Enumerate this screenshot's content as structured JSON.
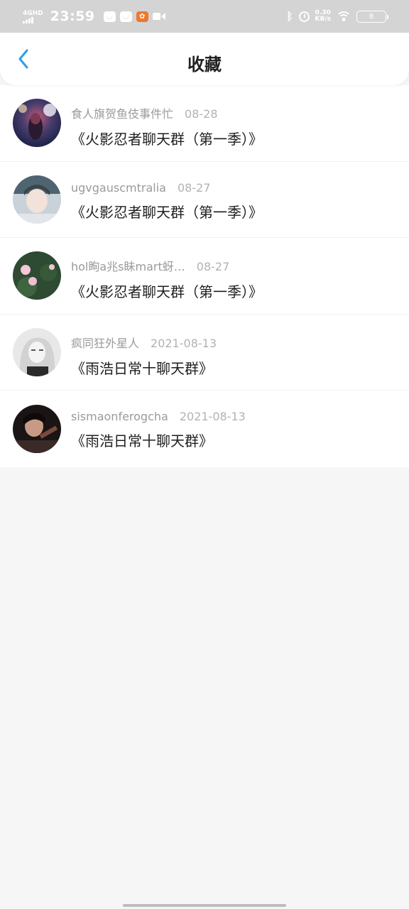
{
  "status_bar": {
    "network_type": "4GHD",
    "time": "23:59",
    "speed_value": "0.30",
    "speed_unit": "KB/s",
    "battery": "8"
  },
  "header": {
    "title": "收藏",
    "back_icon": "chevron-left-icon",
    "accent_color": "#2b9fe6"
  },
  "favorites": [
    {
      "sender": "食人旗贺鱼伎事件忙",
      "date": "08-28",
      "group": "《火影忍者聊天群（第一季）》"
    },
    {
      "sender": "ugvgauscmtralia",
      "date": "08-27",
      "group": "《火影忍者聊天群（第一季）》"
    },
    {
      "sender": "hol眴a兆s眛mart蚜…",
      "date": "08-27",
      "group": "《火影忍者聊天群（第一季）》"
    },
    {
      "sender": "疯同狂外星人",
      "date": "2021-08-13",
      "group": "《雨浩日常十聊天群》"
    },
    {
      "sender": "sismaonferogcha",
      "date": "2021-08-13",
      "group": "《雨浩日常十聊天群》"
    }
  ]
}
